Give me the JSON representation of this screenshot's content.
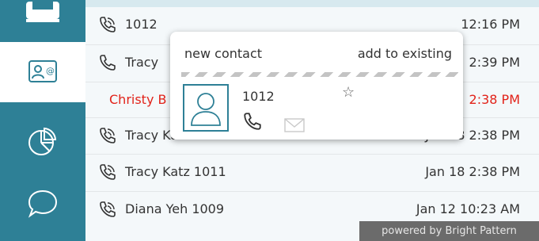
{
  "contacts_rail": {
    "items": [
      {
        "icon": "phone-book-icon"
      },
      {
        "icon": "contact-card-icon",
        "active": true
      },
      {
        "icon": "pie-chart-icon"
      },
      {
        "icon": "chat-bubble-icon"
      }
    ]
  },
  "recent_calls": [
    {
      "name": "1012",
      "time": "12:16 PM",
      "icon": "incoming-call-icon",
      "missed": false
    },
    {
      "name": "Tracy",
      "time": "2:39 PM",
      "icon": "outgoing-call-icon",
      "missed": false
    },
    {
      "name": "Christy B",
      "time": "2:38 PM",
      "icon": "",
      "missed": true
    },
    {
      "name": "Tracy Katz 1011",
      "time": "Jan 18 2:38 PM",
      "icon": "incoming-call-icon",
      "missed": false
    },
    {
      "name": "Tracy Katz 1011",
      "time": "Jan 18 2:38 PM",
      "icon": "incoming-call-icon",
      "missed": false
    },
    {
      "name": "Diana Yeh 1009",
      "time": "Jan 12 10:23 AM",
      "icon": "incoming-call-icon",
      "missed": false
    }
  ],
  "popup": {
    "new_contact_label": "new contact",
    "add_existing_label": "add to existing",
    "number": "1012",
    "star_glyph": "☆"
  },
  "footer": {
    "powered_by": "powered by Bright Pattern"
  },
  "colors": {
    "rail": "#2e8096",
    "missed": "#e2231a",
    "footer": "#6b6b6b"
  }
}
